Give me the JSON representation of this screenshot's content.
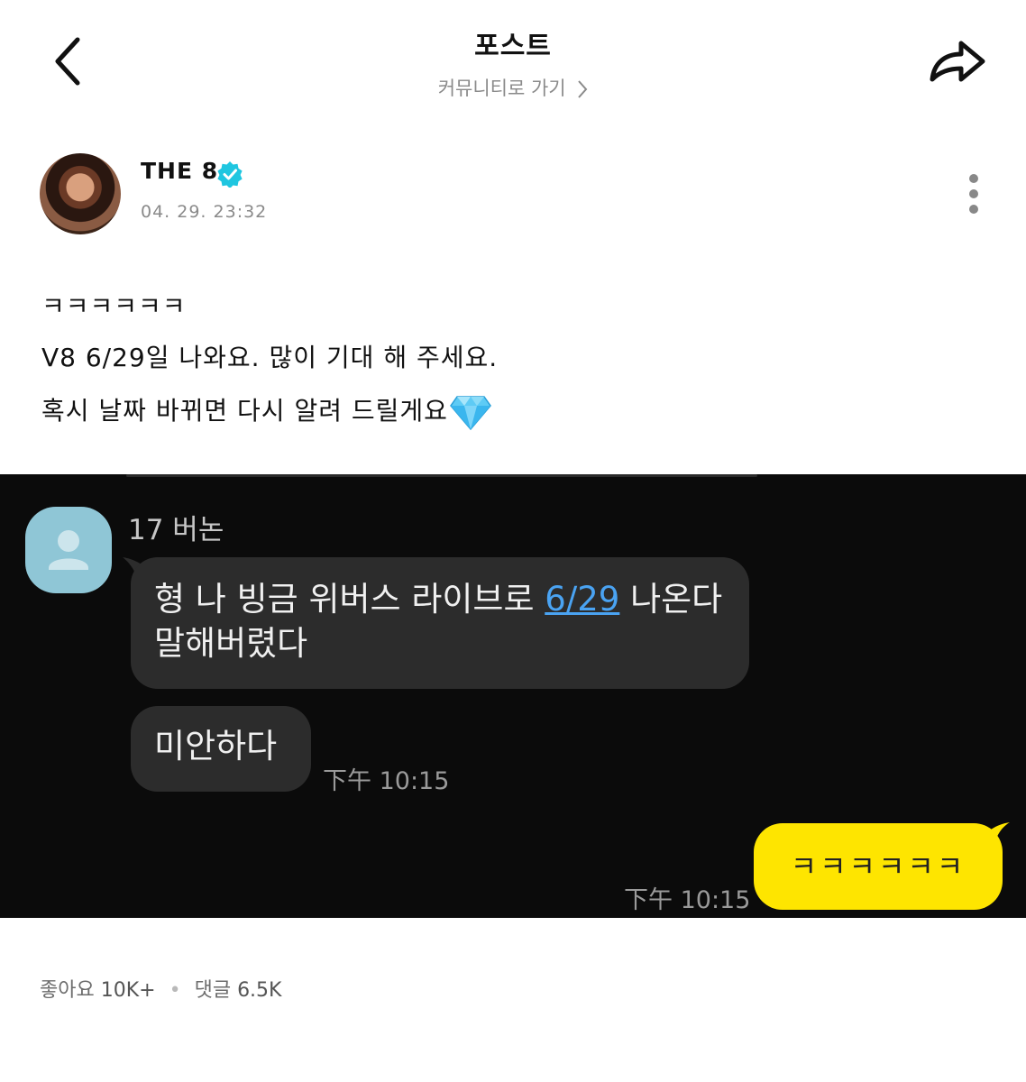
{
  "header": {
    "title": "포스트",
    "community_link": "커뮤니티로 가기"
  },
  "author": {
    "name": "THE 8",
    "timestamp": "04. 29. 23:32",
    "verified": true
  },
  "post": {
    "lines": [
      "ㅋㅋㅋㅋㅋㅋ",
      "V8 6/29일 나와요. 많이 기대 해 주세요.",
      "혹시 날짜 바뀌면 다시 알려 드릴게요"
    ],
    "emoji": "gem-icon"
  },
  "chat_screenshot": {
    "contact_name": "17 버논",
    "msg1_before": "형 나 빙금 위버스 라이브로 ",
    "msg1_link": "6/29",
    "msg1_after": " 나온다",
    "msg1_line2": "말해버렸다",
    "msg2": "미안하다",
    "time_in": "下午 10:15",
    "reply": "ㅋㅋㅋㅋㅋㅋ",
    "time_out": "下午 10:15",
    "colors": {
      "background": "#0b0b0b",
      "incoming_bubble": "#2c2c2c",
      "outgoing_bubble": "#fee500",
      "link": "#4aa3f2"
    }
  },
  "stats": {
    "likes_label": "좋아요",
    "likes_value": "10K+",
    "comments_label": "댓글",
    "comments_value": "6.5K"
  },
  "colors": {
    "verified_badge": "#1fc6e0"
  }
}
